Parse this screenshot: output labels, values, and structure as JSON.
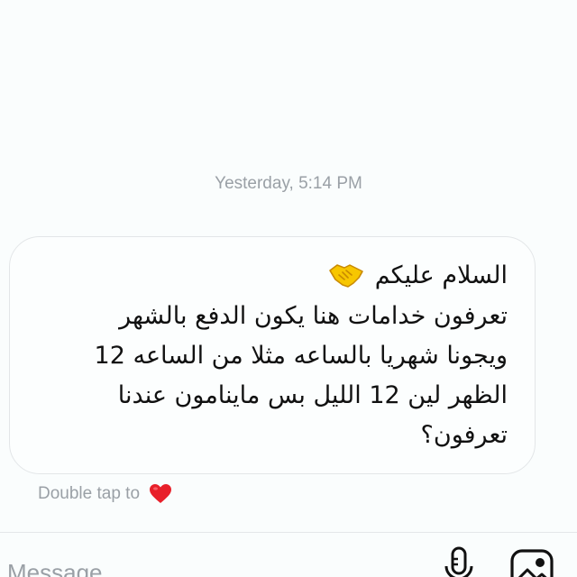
{
  "thread": {
    "timestamp": "Yesterday, 5:14 PM"
  },
  "message": {
    "greeting": "السلام عليكم",
    "greeting_emoji": "handshake-icon",
    "lines": [
      "تعرفون خدامات هنا يكون الدفع بالشهر",
      "ويجونا شهريا بالساعه مثلا من الساعه 12",
      "الظهر لين 12 الليل بس ماينامون عندنا",
      "تعرفون؟"
    ]
  },
  "reaction_hint": {
    "label": "Double tap to",
    "icon": "heart-icon",
    "heart_color": "#e8202a"
  },
  "composer": {
    "placeholder": "Message",
    "mic_icon": "microphone-icon",
    "gallery_icon": "gallery-icon"
  }
}
